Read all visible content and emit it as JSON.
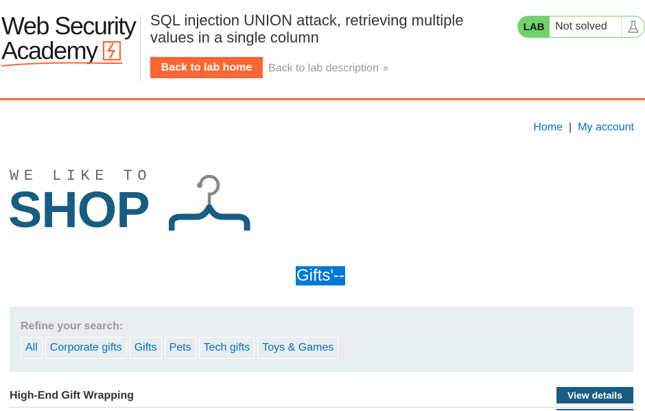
{
  "lab": {
    "logo_line1": "Web Security",
    "logo_line2": "Academy",
    "title": "SQL injection UNION attack, retrieving multiple values in a single column",
    "back_home_label": "Back to lab home",
    "back_description_label": "Back to lab description",
    "status_badge": "LAB",
    "status_text": "Not solved",
    "accent_color": "#ff6633",
    "status_color": "#70d16d"
  },
  "nav": {
    "home": "Home",
    "separator": "|",
    "my_account": "My account"
  },
  "shop_logo": {
    "tagline": "WE LIKE TO",
    "word": "SHOP",
    "brand_color": "#175d81"
  },
  "search": {
    "heading": "Gifts'--"
  },
  "filters": {
    "label": "Refine your search:",
    "categories": [
      "All",
      "Corporate gifts",
      "Gifts",
      "Pets",
      "Tech gifts",
      "Toys & Games"
    ]
  },
  "products": [
    {
      "name": "High-End Gift Wrapping",
      "button_label": "View details"
    }
  ]
}
